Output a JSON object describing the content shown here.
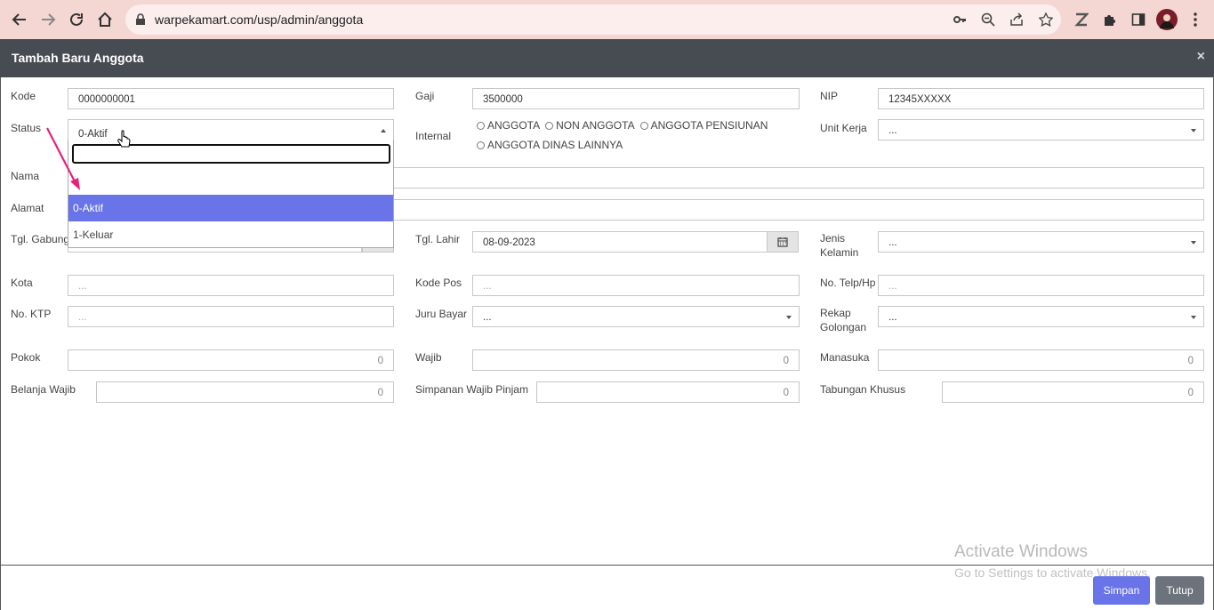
{
  "browser": {
    "url": "warpekamart.com/usp/admin/anggota"
  },
  "modal": {
    "title": "Tambah Baru Anggota",
    "close": "×"
  },
  "form": {
    "kode": {
      "label": "Kode",
      "value": "0000000001"
    },
    "gaji": {
      "label": "Gaji",
      "value": "3500000"
    },
    "nip": {
      "label": "NIP",
      "value": "12345XXXXX"
    },
    "status": {
      "label": "Status",
      "value": "0-Aktif"
    },
    "internal": {
      "label": "Internal",
      "options": [
        "ANGGOTA",
        "NON ANGGOTA",
        "ANGGOTA PENSIUNAN",
        "ANGGOTA DINAS LAINNYA"
      ]
    },
    "unit_kerja": {
      "label": "Unit Kerja",
      "value": "..."
    },
    "nama": {
      "label": "Nama"
    },
    "alamat": {
      "label": "Alamat"
    },
    "tgl_gabung": {
      "label": "Tgl. Gabung"
    },
    "tgl_lahir": {
      "label": "Tgl. Lahir",
      "value": "08-09-2023"
    },
    "jenis_kelamin": {
      "label1": "Jenis",
      "label2": "Kelamin",
      "value": "..."
    },
    "kota": {
      "label": "Kota",
      "placeholder": "..."
    },
    "kode_pos": {
      "label": "Kode Pos",
      "placeholder": "..."
    },
    "no_telp": {
      "label": "No. Telp/Hp",
      "placeholder": "..."
    },
    "no_ktp": {
      "label": "No. KTP",
      "placeholder": "..."
    },
    "juru_bayar": {
      "label": "Juru Bayar",
      "value": "..."
    },
    "rekap_golongan": {
      "label1": "Rekap",
      "label2": "Golongan",
      "value": "..."
    },
    "pokok": {
      "label": "Pokok",
      "value": "0"
    },
    "wajib": {
      "label": "Wajib",
      "value": "0"
    },
    "manasuka": {
      "label": "Manasuka",
      "value": "0"
    },
    "belanja_wajib": {
      "label": "Belanja Wajib",
      "value": "0"
    },
    "simpanan_wajib_pinjam": {
      "label": "Simpanan Wajib Pinjam",
      "value": "0"
    },
    "tabungan_khusus": {
      "label": "Tabungan Khusus",
      "value": "0"
    }
  },
  "status_dropdown": {
    "options": [
      "0-Aktif",
      "1-Keluar"
    ],
    "highlighted": "0-Aktif"
  },
  "footer": {
    "save": "Simpan",
    "close": "Tutup"
  },
  "watermark": {
    "line1": "Activate Windows",
    "line2": "Go to Settings to activate Windows."
  },
  "colors": {
    "chrome_bg": "#f4d6d3",
    "header_bg": "#474b52",
    "highlight": "#6874e8",
    "save_btn": "#6874e8",
    "close_btn": "#6d737c",
    "annotation_arrow": "#e8207a"
  }
}
